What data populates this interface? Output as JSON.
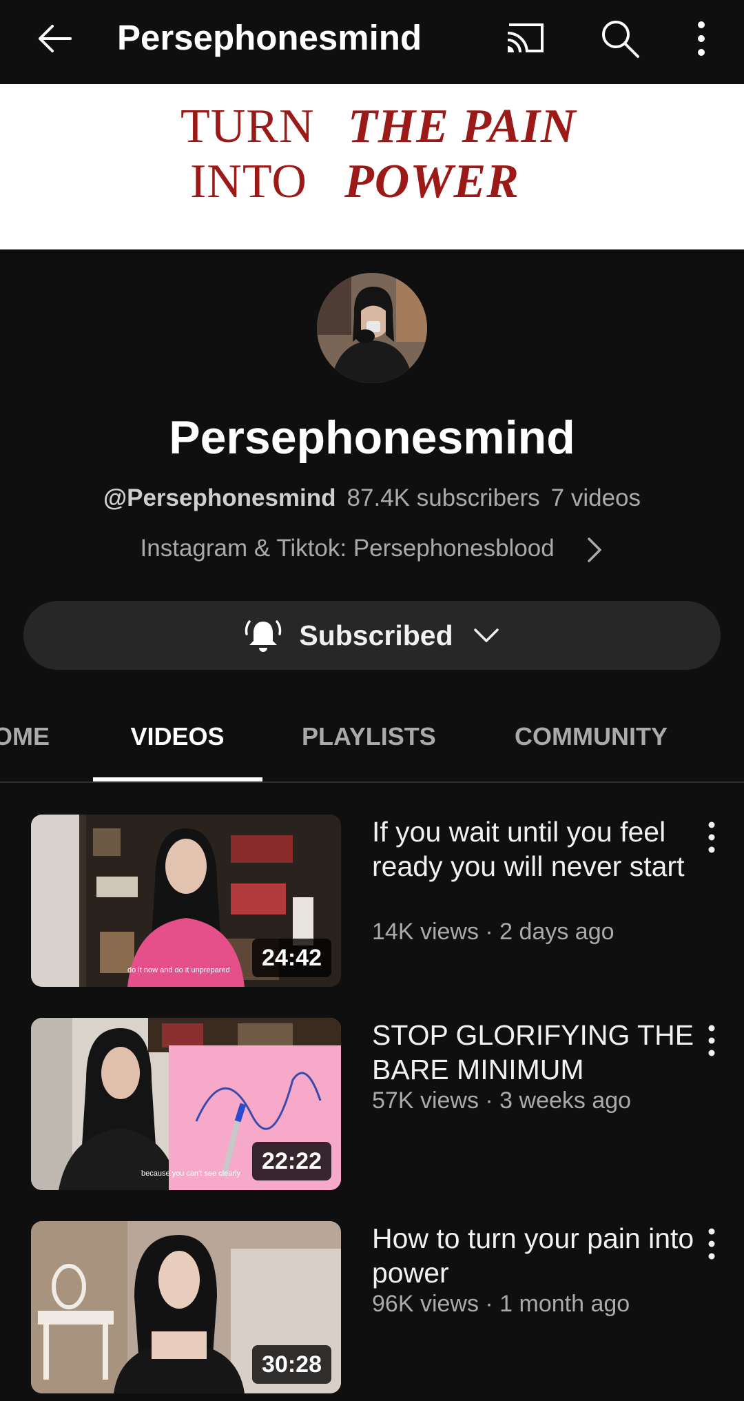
{
  "topbar": {
    "title": "Persephonesmind",
    "icons": [
      "arrow-left-icon",
      "cast-icon",
      "search-icon",
      "more-vert-icon"
    ]
  },
  "banner": {
    "line1_left": "TURN",
    "line1_right": "THE PAIN",
    "line2_left": "INTO",
    "line2_right": "POWER",
    "color": "#9b1a17"
  },
  "channel": {
    "name": "Persephonesmind",
    "handle": "@Persephonesmind",
    "subscribers": "87.4K subscribers",
    "videos_count": "7 videos",
    "description": "Instagram & Tiktok: Persephonesblood"
  },
  "subscribe": {
    "label": "Subscribed"
  },
  "tabs": [
    {
      "label": "OME"
    },
    {
      "label": "VIDEOS"
    },
    {
      "label": "PLAYLISTS"
    },
    {
      "label": "COMMUNITY"
    }
  ],
  "videos": [
    {
      "title": "If you wait until you feel ready you will never start",
      "meta": "14K views · 2 days ago",
      "duration": "24:42",
      "caption": "do it now and do it unprepared"
    },
    {
      "title": "STOP GLORIFYING THE BARE MINIMUM",
      "meta": "57K views · 3 weeks ago",
      "duration": "22:22",
      "caption": "because you can't see clearly"
    },
    {
      "title": "How to turn your pain into power",
      "meta": "96K views · 1 month ago",
      "duration": "30:28",
      "caption": ""
    }
  ]
}
